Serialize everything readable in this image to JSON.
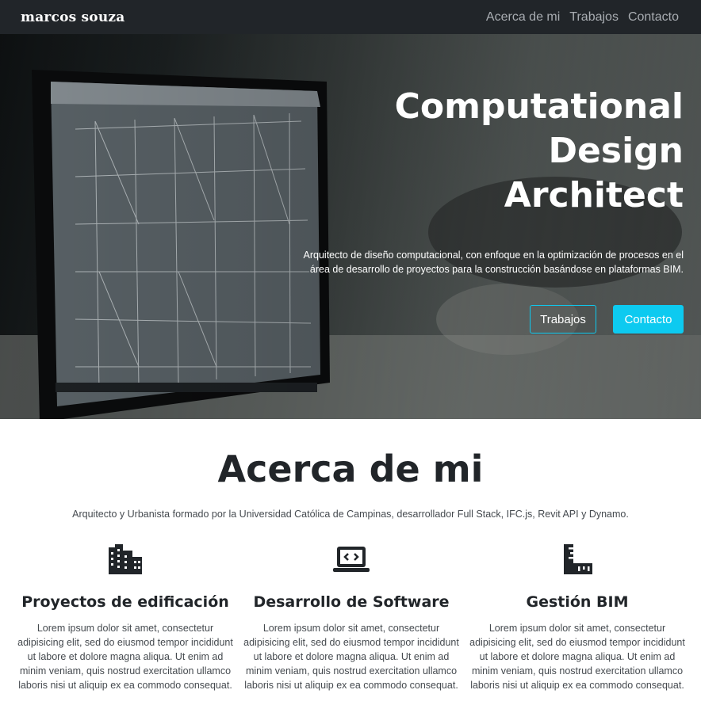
{
  "nav": {
    "brand": "marcos souza",
    "links": [
      "Acerca de mi",
      "Trabajos",
      "Contacto"
    ]
  },
  "hero": {
    "title_lines": [
      "Computational",
      "Design",
      "Architect"
    ],
    "subtitle": "Arquitecto de diseño computacional, con enfoque en la optimización de procesos en el área de desarrollo de proyectos para la construcción basándose en plataformas BIM.",
    "buttons": {
      "outline": "Trabajos",
      "primary": "Contacto"
    }
  },
  "about": {
    "title": "Acerca de mi",
    "text": "Arquitecto y Urbanista formado por la Universidad Católica de Campinas, desarrollador Full Stack, IFC.js, Revit API y Dynamo.",
    "features": [
      {
        "icon": "buildings-icon",
        "title": "Proyectos de edificación",
        "text": "Lorem ipsum dolor sit amet, consectetur adipisicing elit, sed do eiusmod tempor incididunt ut labore et dolore magna aliqua. Ut enim ad minim veniam, quis nostrud exercitation ullamco laboris nisi ut aliquip ex ea commodo consequat."
      },
      {
        "icon": "laptop-code-icon",
        "title": "Desarrollo de Software",
        "text": "Lorem ipsum dolor sit amet, consectetur adipisicing elit, sed do eiusmod tempor incididunt ut labore et dolore magna aliqua. Ut enim ad minim veniam, quis nostrud exercitation ullamco laboris nisi ut aliquip ex ea commodo consequat."
      },
      {
        "icon": "ruler-combined-icon",
        "title": "Gestión BIM",
        "text": "Lorem ipsum dolor sit amet, consectetur adipisicing elit, sed do eiusmod tempor incididunt ut labore et dolore magna aliqua. Ut enim ad minim veniam, quis nostrud exercitation ullamco laboris nisi ut aliquip ex ea commodo consequat."
      }
    ]
  },
  "colors": {
    "navbar": "#212529",
    "accent": "#0dcaf0",
    "text": "#212529"
  }
}
